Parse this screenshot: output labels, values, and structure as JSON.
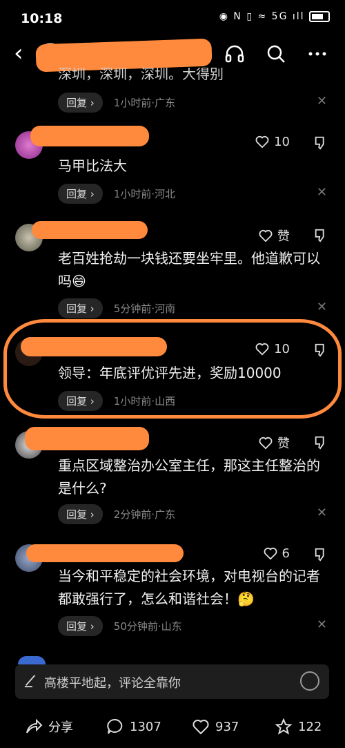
{
  "status": {
    "time": "10:18",
    "icons": "◉ N ▯ ≈ 5G ıll"
  },
  "partial_text": "深圳，深圳，深圳。大得别",
  "comments": [
    {
      "likes": "",
      "text": "",
      "time": "1小时前",
      "region": "广东"
    },
    {
      "likes": "10",
      "text": "马甲比法大",
      "time": "1小时前",
      "region": "河北"
    },
    {
      "likes": "赞",
      "text": "老百姓抢劫一块钱还要坐牢里。他道歉可以吗😄",
      "time": "5分钟前",
      "region": "河南"
    },
    {
      "likes": "10",
      "text": "领导：年底评优评先进，奖励10000",
      "time": "1小时前",
      "region": "山西"
    },
    {
      "likes": "赞",
      "text": "重点区域整治办公室主任，那这主任整治的是什么?",
      "time": "2分钟前",
      "region": "广东"
    },
    {
      "likes": "6",
      "text": "当今和平稳定的社会环境，对电视台的记者都敢强行了，怎么和谐社会！🤔",
      "time": "50分钟前",
      "region": "山东"
    }
  ],
  "reply_label": "回复 ›",
  "meta_sep": " · ",
  "input": {
    "placeholder": "高楼平地起，评论全靠你"
  },
  "bottom": {
    "share": "分享",
    "comments": "1307",
    "likes": "937",
    "favorites": "122"
  },
  "colors": {
    "redaction": "#ff8a3d",
    "background": "#000000"
  }
}
